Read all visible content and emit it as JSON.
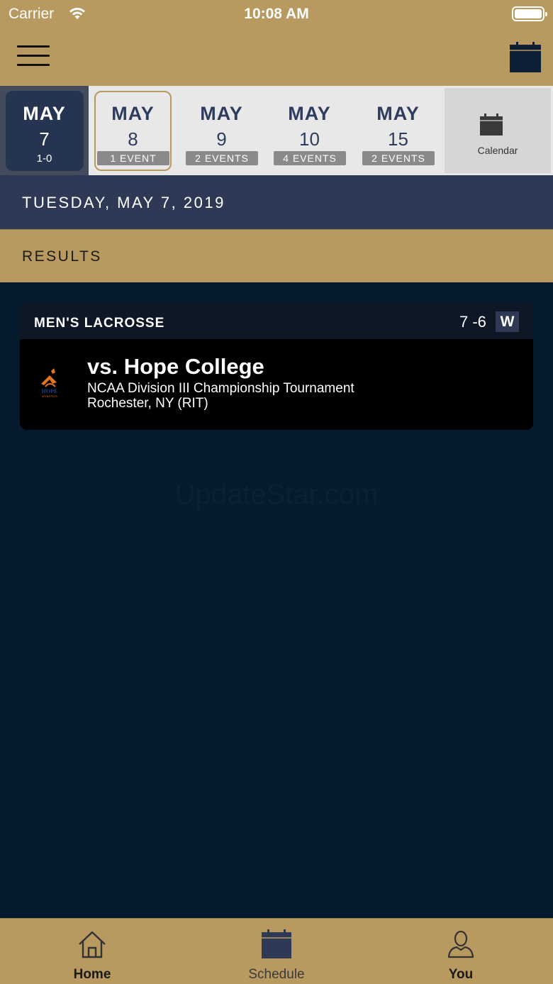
{
  "status_bar": {
    "carrier": "Carrier",
    "time": "10:08 AM"
  },
  "date_strip": {
    "days": [
      {
        "month": "MAY",
        "day": "7",
        "sub": "1-0",
        "state": "active"
      },
      {
        "month": "MAY",
        "day": "8",
        "sub": "1 EVENT",
        "state": "selected"
      },
      {
        "month": "MAY",
        "day": "9",
        "sub": "2 EVENTS",
        "state": "normal"
      },
      {
        "month": "MAY",
        "day": "10",
        "sub": "4 EVENTS",
        "state": "normal"
      },
      {
        "month": "MAY",
        "day": "15",
        "sub": "2 EVENTS",
        "state": "normal"
      }
    ],
    "calendar_label": "Calendar"
  },
  "date_header": "TUESDAY, MAY 7, 2019",
  "section_header": "RESULTS",
  "event": {
    "sport": "MEN'S LACROSSE",
    "score": "7 -6",
    "result": "W",
    "opponent": "vs. Hope College",
    "tournament": "NCAA Division III Championship Tournament",
    "location": "Rochester, NY (RIT)",
    "logo_text": "HOPE",
    "logo_subtext": "ATHLETICS"
  },
  "watermark": "UpdateStar.com",
  "tabs": [
    {
      "label": "Home",
      "icon": "home-icon"
    },
    {
      "label": "Schedule",
      "icon": "calendar-icon"
    },
    {
      "label": "You",
      "icon": "person-icon"
    }
  ],
  "colors": {
    "gold": "#b8995f",
    "navy": "#2e3a55",
    "background": "#061a2d"
  }
}
